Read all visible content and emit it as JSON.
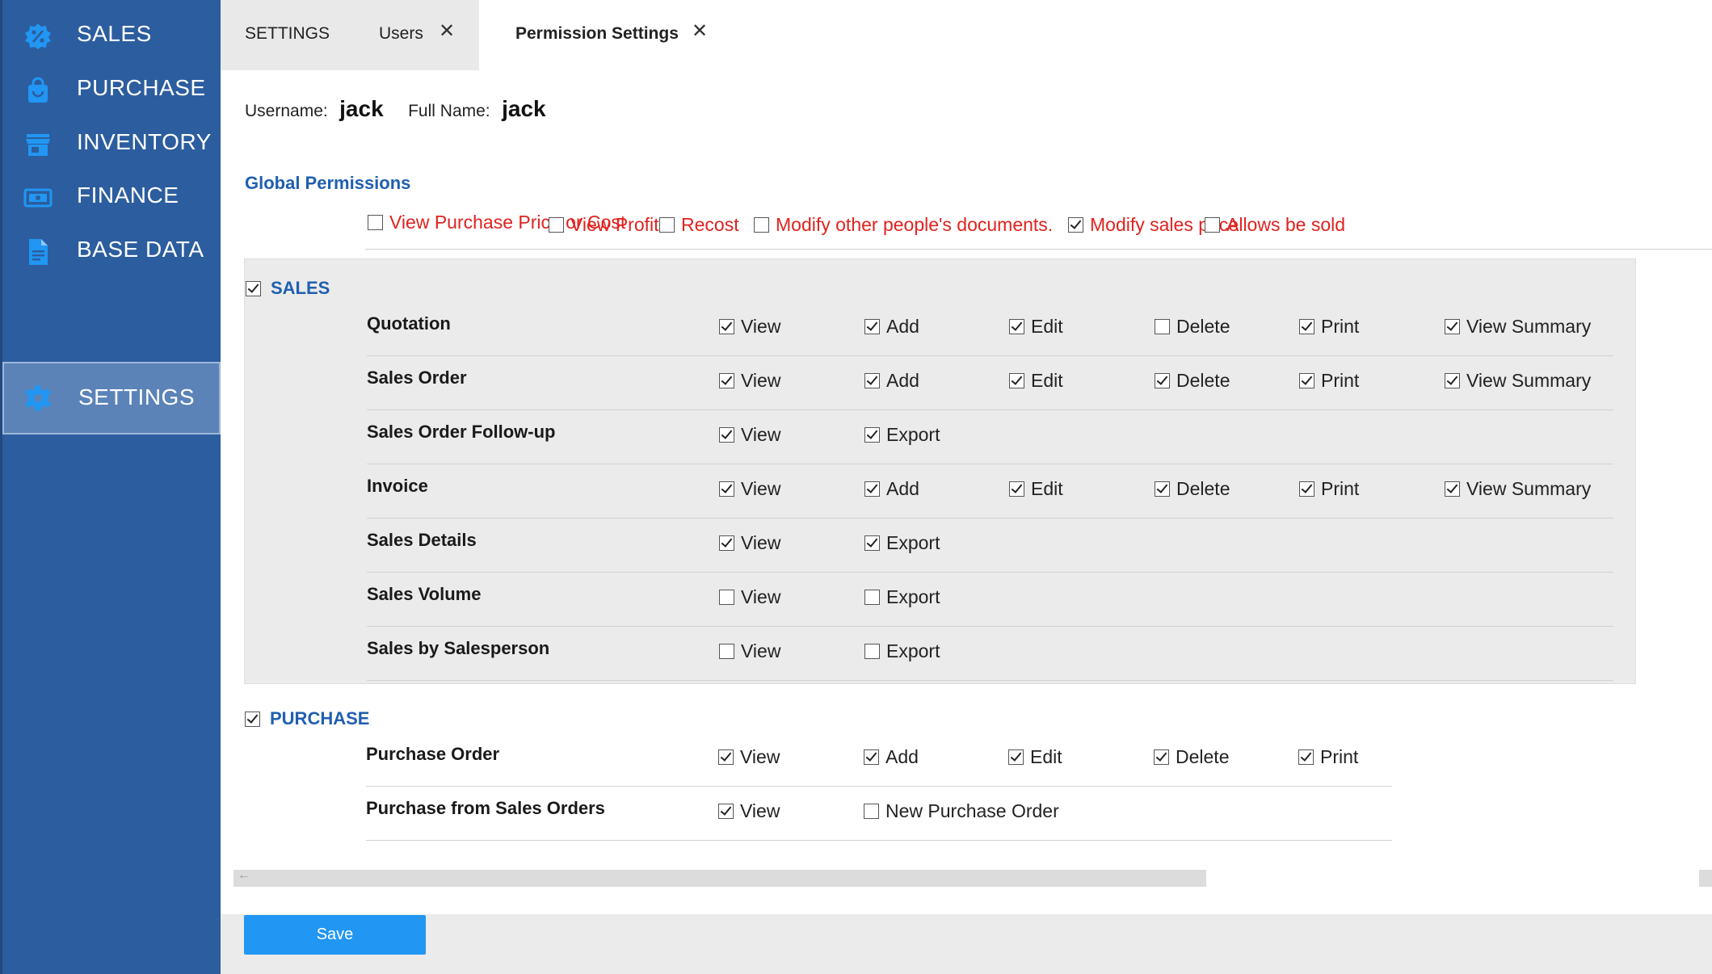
{
  "sidebar": {
    "items": [
      {
        "label": "SALES",
        "icon": "percent-badge-icon"
      },
      {
        "label": "PURCHASE",
        "icon": "shopping-bag-icon"
      },
      {
        "label": "INVENTORY",
        "icon": "store-icon"
      },
      {
        "label": "FINANCE",
        "icon": "money-bill-icon"
      },
      {
        "label": "BASE DATA",
        "icon": "document-icon"
      },
      {
        "label": "SETTINGS",
        "icon": "gear-icon",
        "active": true
      }
    ]
  },
  "tabs": {
    "settings": "SETTINGS",
    "users": "Users",
    "permission": "Permission Settings",
    "close_glyph": "✕"
  },
  "user": {
    "username_label": "Username:",
    "username": "jack",
    "fullname_label": "Full Name:",
    "fullname": "jack"
  },
  "global": {
    "title": "Global Permissions",
    "items": [
      {
        "label": "View Purchase Price or Cost",
        "checked": false
      },
      {
        "label": "View Profit",
        "checked": false
      },
      {
        "label": "Recost",
        "checked": false
      },
      {
        "label": "Modify other people's documents.",
        "checked": false
      },
      {
        "label": "Modify sales price",
        "checked": true
      },
      {
        "label": "Allows be sold",
        "checked": false
      }
    ]
  },
  "sales": {
    "title": "SALES",
    "checked": true,
    "rows": [
      {
        "label": "Quotation",
        "perms": [
          {
            "label": "View",
            "checked": true
          },
          {
            "label": "Add",
            "checked": true
          },
          {
            "label": "Edit",
            "checked": true
          },
          {
            "label": "Delete",
            "checked": false
          },
          {
            "label": "Print",
            "checked": true
          },
          {
            "label": "View Summary",
            "checked": true
          }
        ]
      },
      {
        "label": "Sales Order",
        "perms": [
          {
            "label": "View",
            "checked": true
          },
          {
            "label": "Add",
            "checked": true
          },
          {
            "label": "Edit",
            "checked": true
          },
          {
            "label": "Delete",
            "checked": true
          },
          {
            "label": "Print",
            "checked": true
          },
          {
            "label": "View Summary",
            "checked": true
          }
        ]
      },
      {
        "label": "Sales Order Follow-up",
        "perms": [
          {
            "label": "View",
            "checked": true
          },
          {
            "label": "Export",
            "checked": true
          }
        ]
      },
      {
        "label": "Invoice",
        "perms": [
          {
            "label": "View",
            "checked": true
          },
          {
            "label": "Add",
            "checked": true
          },
          {
            "label": "Edit",
            "checked": true
          },
          {
            "label": "Delete",
            "checked": true
          },
          {
            "label": "Print",
            "checked": true
          },
          {
            "label": "View Summary",
            "checked": true
          }
        ]
      },
      {
        "label": "Sales Details",
        "perms": [
          {
            "label": "View",
            "checked": true
          },
          {
            "label": "Export",
            "checked": true
          }
        ]
      },
      {
        "label": "Sales Volume",
        "perms": [
          {
            "label": "View",
            "checked": false
          },
          {
            "label": "Export",
            "checked": false
          }
        ]
      },
      {
        "label": "Sales by Salesperson",
        "perms": [
          {
            "label": "View",
            "checked": false
          },
          {
            "label": "Export",
            "checked": false
          }
        ]
      }
    ]
  },
  "purchase": {
    "title": "PURCHASE",
    "checked": true,
    "rows": [
      {
        "label": "Purchase Order",
        "perms": [
          {
            "label": "View",
            "checked": true
          },
          {
            "label": "Add",
            "checked": true
          },
          {
            "label": "Edit",
            "checked": true
          },
          {
            "label": "Delete",
            "checked": true
          },
          {
            "label": "Print",
            "checked": true
          }
        ]
      },
      {
        "label": "Purchase from Sales Orders",
        "perms": [
          {
            "label": "View",
            "checked": true
          },
          {
            "label": "New Purchase Order",
            "checked": false
          }
        ]
      }
    ]
  },
  "footer": {
    "save_label": "Save"
  },
  "colors": {
    "sidebar": "#2c5d9f",
    "accent": "#1f5fb0",
    "global_text": "#e0221f",
    "save": "#2196f3"
  }
}
